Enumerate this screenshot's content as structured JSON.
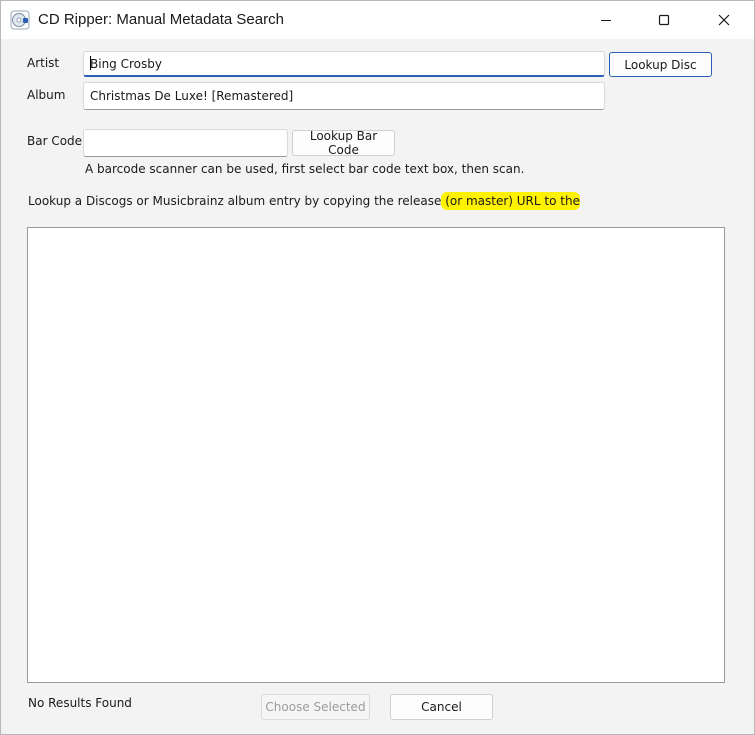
{
  "window": {
    "title": "CD Ripper: Manual Metadata Search",
    "app_icon": "cd-ripper-icon",
    "controls": {
      "minimize": "minimize-icon",
      "maximize": "maximize-icon",
      "close": "close-icon"
    }
  },
  "form": {
    "artist_label": "Artist",
    "artist_value": "Bing Crosby",
    "album_label": "Album",
    "album_value": "Christmas De Luxe! [Remastered]",
    "lookup_disc_label": "Lookup Disc",
    "barcode_label": "Bar Code",
    "barcode_value": "",
    "lookup_barcode_label": "Lookup Bar Code",
    "barcode_hint": "A barcode scanner can be used, first select bar code text box, then scan.",
    "instruction_plain": "Lookup a Discogs or Musicbrainz album entry by copying the release",
    "instruction_highlighted": " (or master) URL to the"
  },
  "results": {
    "items": []
  },
  "footer": {
    "status": "No Results Found",
    "choose_label": "Choose Selected",
    "cancel_label": "Cancel"
  },
  "colors": {
    "accent": "#2b5fb3",
    "highlight": "#fff200",
    "background": "#f3f3f3"
  }
}
